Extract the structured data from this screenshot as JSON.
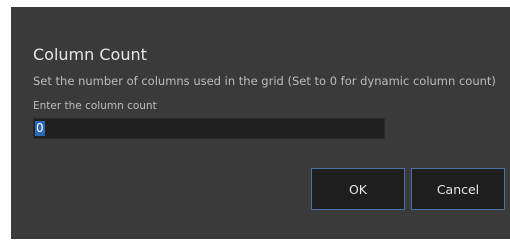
{
  "dialog": {
    "title": "Column Count",
    "description": "Set the number of columns used in the grid (Set to 0 for dynamic column count)",
    "field_label": "Enter the column count",
    "input_value": "0",
    "ok_label": "OK",
    "cancel_label": "Cancel"
  },
  "colors": {
    "background": "#3a3a3a",
    "input_background": "#202020",
    "selection": "#2d68b8",
    "button_border": "#4a72a9"
  }
}
